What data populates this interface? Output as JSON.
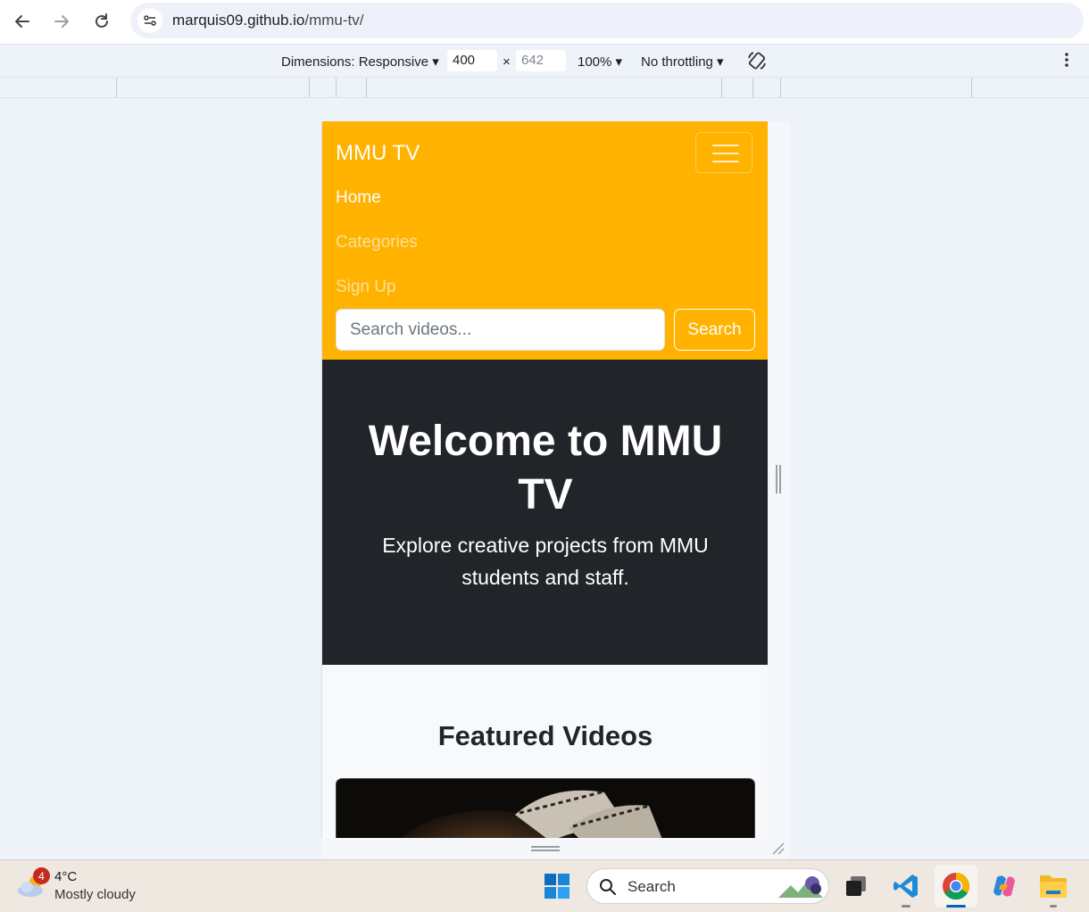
{
  "browser": {
    "url_host": "marquis09.github.io",
    "url_path": "/mmu-tv/"
  },
  "devtools": {
    "dimensions_label": "Dimensions: Responsive",
    "width_value": "400",
    "times": "×",
    "height_placeholder": "642",
    "zoom": "100%",
    "throttling": "No throttling"
  },
  "site": {
    "brand": "MMU TV",
    "nav": [
      {
        "label": "Home",
        "active": true
      },
      {
        "label": "Categories",
        "active": false
      },
      {
        "label": "Sign Up",
        "active": false
      }
    ],
    "search_placeholder": "Search videos...",
    "search_button": "Search",
    "hero_title": "Welcome to MMU TV",
    "hero_subtitle": "Explore creative projects from MMU students and staff.",
    "featured_title": "Featured Videos"
  },
  "taskbar": {
    "weather_temp": "4°C",
    "weather_condition": "Mostly cloudy",
    "weather_badge": "4",
    "search_label": "Search"
  },
  "colors": {
    "navbar": "#ffb200",
    "hero": "#212529",
    "page_bg": "#f8f9fa"
  }
}
